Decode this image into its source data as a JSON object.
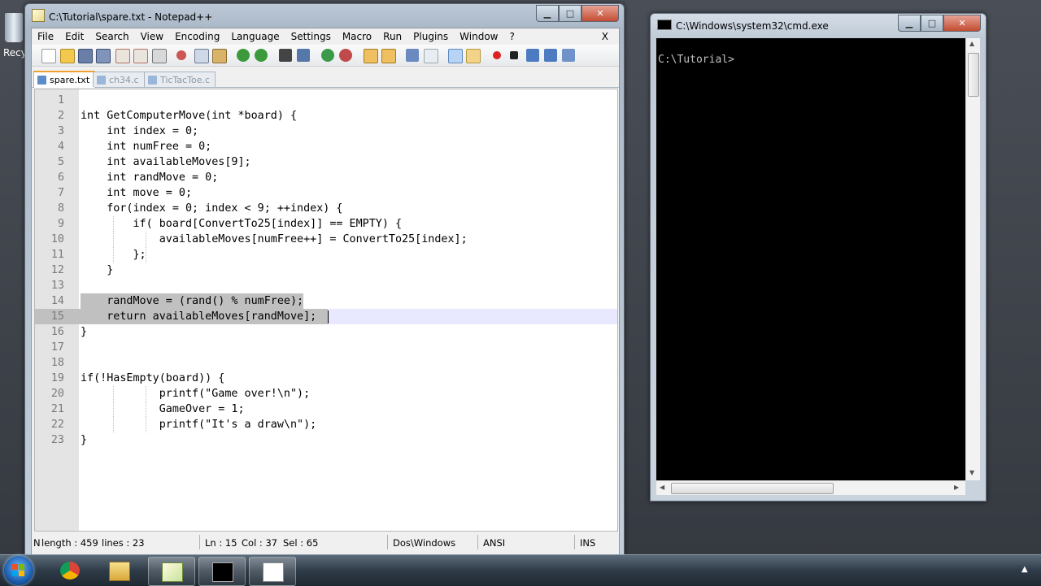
{
  "desktop": {
    "recycle_label": "Recy"
  },
  "npp": {
    "title": "C:\\Tutorial\\spare.txt - Notepad++",
    "window_buttons": {
      "minimize": "▁",
      "maximize": "□",
      "close": "✕"
    },
    "menu": [
      "File",
      "Edit",
      "Search",
      "View",
      "Encoding",
      "Language",
      "Settings",
      "Macro",
      "Run",
      "Plugins",
      "Window",
      "?"
    ],
    "menu_close": "X",
    "tabs": [
      {
        "label": "spare.txt",
        "active": true
      },
      {
        "label": "ch34.c",
        "active": false
      },
      {
        "label": "TicTacToe.c",
        "active": false
      }
    ],
    "lines": [
      {
        "n": "1",
        "code": ""
      },
      {
        "n": "2",
        "code": "int GetComputerMove(int *board) {"
      },
      {
        "n": "3",
        "code": "    int index = 0;"
      },
      {
        "n": "4",
        "code": "    int numFree = 0;"
      },
      {
        "n": "5",
        "code": "    int availableMoves[9];"
      },
      {
        "n": "6",
        "code": "    int randMove = 0;"
      },
      {
        "n": "7",
        "code": "    int move = 0;"
      },
      {
        "n": "8",
        "code": "    for(index = 0; index < 9; ++index) {"
      },
      {
        "n": "9",
        "code": "        if( board[ConvertTo25[index]] == EMPTY) {"
      },
      {
        "n": "10",
        "code": "            availableMoves[numFree++] = ConvertTo25[index];"
      },
      {
        "n": "11",
        "code": "        };"
      },
      {
        "n": "12",
        "code": "    }"
      },
      {
        "n": "13",
        "code": ""
      },
      {
        "n": "14",
        "code": "    randMove = (rand() % numFree);"
      },
      {
        "n": "15",
        "code": "    return availableMoves[randMove];"
      },
      {
        "n": "16",
        "code": "}"
      },
      {
        "n": "17",
        "code": ""
      },
      {
        "n": "18",
        "code": ""
      },
      {
        "n": "19",
        "code": "if(!HasEmpty(board)) {"
      },
      {
        "n": "20",
        "code": "            printf(\"Game over!\\n\");"
      },
      {
        "n": "21",
        "code": "            GameOver = 1;"
      },
      {
        "n": "22",
        "code": "            printf(\"It's a draw\\n\");"
      },
      {
        "n": "23",
        "code": "}"
      }
    ],
    "status": {
      "mode": "N",
      "length": "length : 459",
      "lines": "lines : 23",
      "ln": "Ln : 15",
      "col": "Col : 37",
      "sel": "Sel : 65",
      "eol": "Dos\\Windows",
      "encoding": "ANSI",
      "ins": "INS"
    }
  },
  "cmd": {
    "title": "C:\\Windows\\system32\\cmd.exe",
    "prompt": "C:\\Tutorial>",
    "window_buttons": {
      "minimize": "▁",
      "maximize": "□",
      "close": "✕"
    }
  },
  "taskbar": {
    "tray_arrow": "▲"
  },
  "colors": {
    "selection": "#c0c0c0",
    "current_line": "#e8e8ff",
    "gutter": "#e4e4e4",
    "console_bg": "#000000",
    "console_text": "#c0c0c0"
  }
}
